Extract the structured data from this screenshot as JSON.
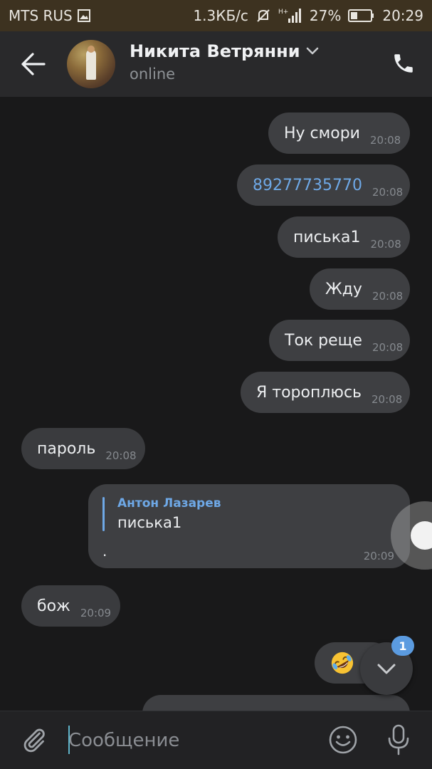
{
  "status_bar": {
    "carrier": "MTS RUS",
    "speed": "1.3КБ/с",
    "battery": "27%",
    "time": "20:29"
  },
  "header": {
    "contact_name": "Никита Ветрянни",
    "contact_status": "online"
  },
  "messages": [
    {
      "text": "Ну смори",
      "time": "20:08",
      "direction": "out"
    },
    {
      "text": "89277735770",
      "time": "20:08",
      "direction": "out",
      "is_link": true
    },
    {
      "text": "писька1",
      "time": "20:08",
      "direction": "out"
    },
    {
      "text": "Жду",
      "time": "20:08",
      "direction": "out"
    },
    {
      "text": "Ток реще",
      "time": "20:08",
      "direction": "out"
    },
    {
      "text": "Я тороплюсь",
      "time": "20:08",
      "direction": "out"
    },
    {
      "text": "пароль",
      "time": "20:08",
      "direction": "in"
    }
  ],
  "reply_message": {
    "quoted_author": "Антон Лазарев",
    "quoted_text": "писька1",
    "text": ".",
    "time": "20:09"
  },
  "message_after_reply": {
    "text": "бож",
    "time": "20:09",
    "direction": "in"
  },
  "emoji_message": {
    "emoji": "rolling-on-floor-laughing-emoji"
  },
  "scroll_down": {
    "unread_count": "1"
  },
  "composer": {
    "placeholder": "Сообщение"
  },
  "colors": {
    "background": "#19191a",
    "header": "#29292b",
    "bubble": "#3e3f42",
    "accent_link": "#6ea8e6",
    "status_bar": "#3d3220"
  }
}
